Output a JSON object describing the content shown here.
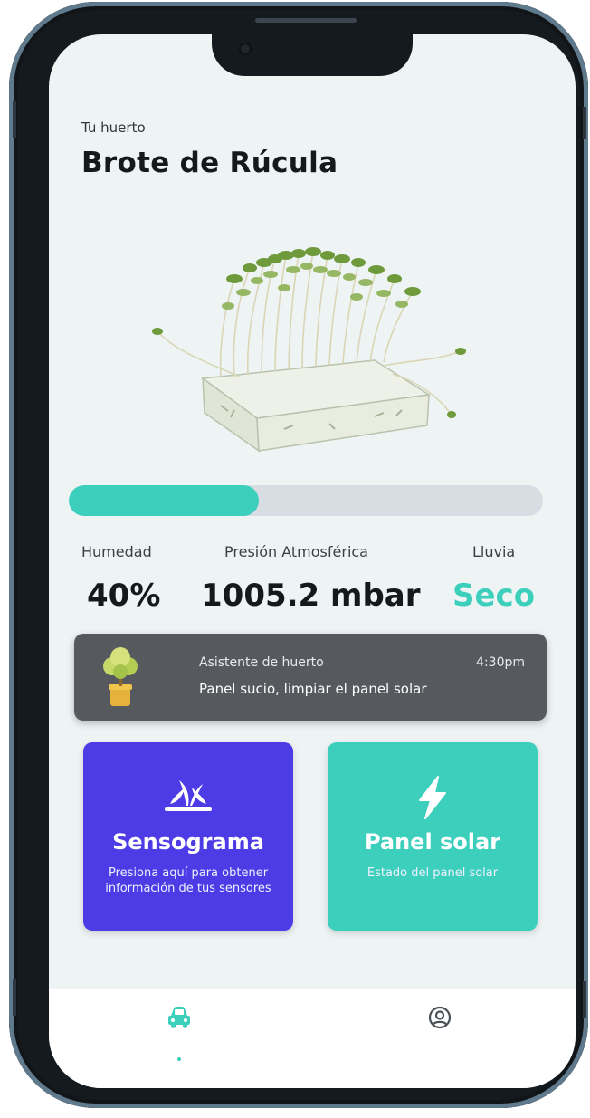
{
  "header": {
    "subtitle": "Tu huerto",
    "title": "Brote de Rúcula"
  },
  "plant_image": {
    "icon": "arugula-sprouts-image"
  },
  "progress": {
    "value": 0.4
  },
  "stats": [
    {
      "label": "Humedad",
      "value": "40%"
    },
    {
      "label": "Presión Atmosférica",
      "value": "1005.2 mbar"
    },
    {
      "label": "Lluvia",
      "value": "Seco"
    }
  ],
  "notification": {
    "sender": "Asistente de huerto",
    "time": "4:30pm",
    "message": "Panel sucio, limpiar el panel solar",
    "icon": "potted-tree-icon"
  },
  "cards": [
    {
      "title": "Sensograma",
      "description": "Presiona aquí para obtener información de tus sensores",
      "icon": "sprout-icon",
      "color": "#4d3be5"
    },
    {
      "title": "Panel solar",
      "description": "Estado del panel solar",
      "icon": "lightning-icon",
      "color": "#3ccfbc"
    }
  ],
  "bottom_nav": [
    {
      "icon": "car-icon",
      "active": true
    },
    {
      "icon": "user-circle-icon",
      "active": false
    }
  ],
  "colors": {
    "accent": "#3ccfbc",
    "primary": "#4d3be5",
    "notification_bg": "#565a5e"
  }
}
